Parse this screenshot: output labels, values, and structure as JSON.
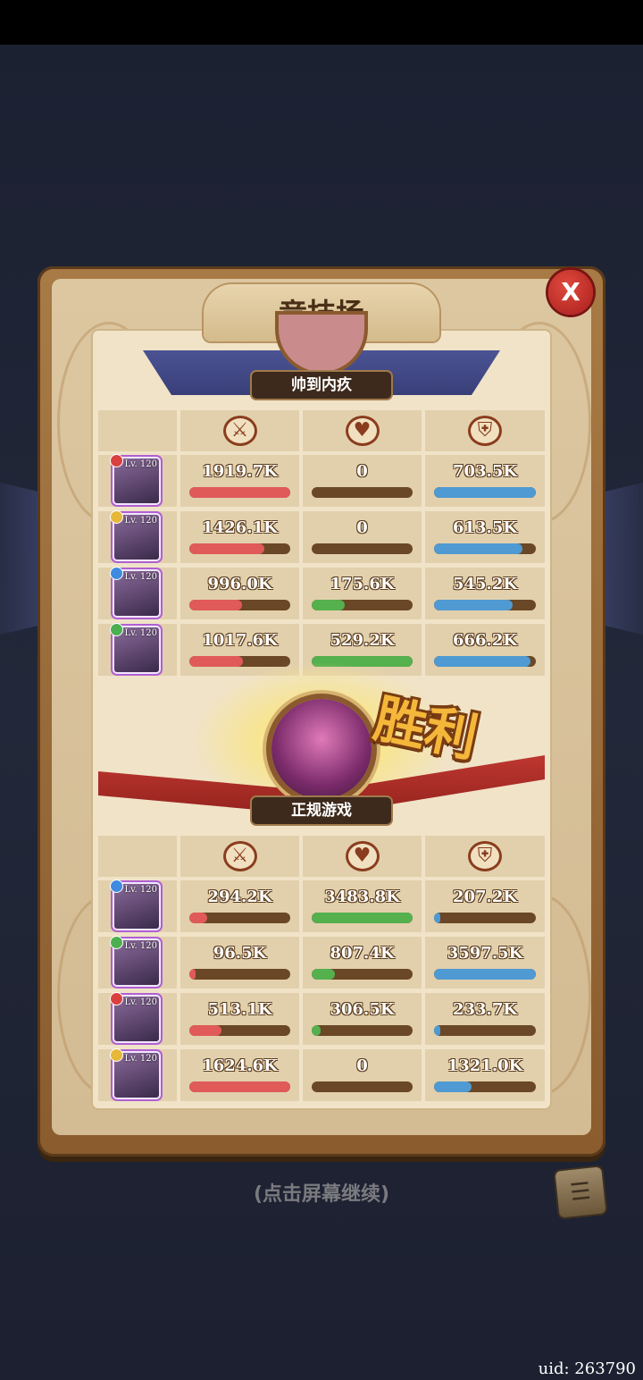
{
  "screen": {
    "title": "竞技场",
    "close_label": "X",
    "victory_label": "胜利",
    "continue_hint": "(点击屏幕继续)",
    "uid": "uid: 263790",
    "icons": {
      "attack": "sword-icon",
      "heal": "heart-icon",
      "defense": "shield-icon",
      "close": "close-icon",
      "log": "battle-log-icon"
    }
  },
  "colors": {
    "attack_bar": "#e05a5a",
    "heal_bar": "#55b04e",
    "defense_bar": "#4f9ad2",
    "bar_track": "#6a4726"
  },
  "top_team": {
    "player_name": "帅到内疚",
    "heroes": [
      {
        "level": "Lv. 120",
        "faction_color": "#d94040",
        "attack": "1919.7K",
        "attack_pct": 1.0,
        "heal": "0",
        "heal_pct": 0,
        "defense": "703.5K",
        "defense_pct": 1.0
      },
      {
        "level": "Lv. 120",
        "faction_color": "#e6b83a",
        "attack": "1426.1K",
        "attack_pct": 0.74,
        "heal": "0",
        "heal_pct": 0,
        "defense": "613.5K",
        "defense_pct": 0.87
      },
      {
        "level": "Lv. 120",
        "faction_color": "#3f8be0",
        "attack": "996.0K",
        "attack_pct": 0.52,
        "heal": "175.6K",
        "heal_pct": 0.33,
        "defense": "545.2K",
        "defense_pct": 0.77
      },
      {
        "level": "Lv. 120",
        "faction_color": "#4caf50",
        "attack": "1017.6K",
        "attack_pct": 0.53,
        "heal": "529.2K",
        "heal_pct": 1.0,
        "defense": "666.2K",
        "defense_pct": 0.95
      }
    ]
  },
  "bottom_team": {
    "player_name": "正规游戏",
    "heroes": [
      {
        "level": "Lv. 120",
        "faction_color": "#3f8be0",
        "attack": "294.2K",
        "attack_pct": 0.18,
        "heal": "3483.8K",
        "heal_pct": 1.0,
        "defense": "207.2K",
        "defense_pct": 0.06
      },
      {
        "level": "Lv. 120",
        "faction_color": "#4caf50",
        "attack": "96.5K",
        "attack_pct": 0.06,
        "heal": "807.4K",
        "heal_pct": 0.23,
        "defense": "3597.5K",
        "defense_pct": 1.0
      },
      {
        "level": "Lv. 120",
        "faction_color": "#d94040",
        "attack": "513.1K",
        "attack_pct": 0.32,
        "heal": "306.5K",
        "heal_pct": 0.09,
        "defense": "233.7K",
        "defense_pct": 0.06
      },
      {
        "level": "Lv. 120",
        "faction_color": "#e6b83a",
        "attack": "1624.6K",
        "attack_pct": 1.0,
        "heal": "0",
        "heal_pct": 0,
        "defense": "1321.0K",
        "defense_pct": 0.37
      }
    ]
  }
}
